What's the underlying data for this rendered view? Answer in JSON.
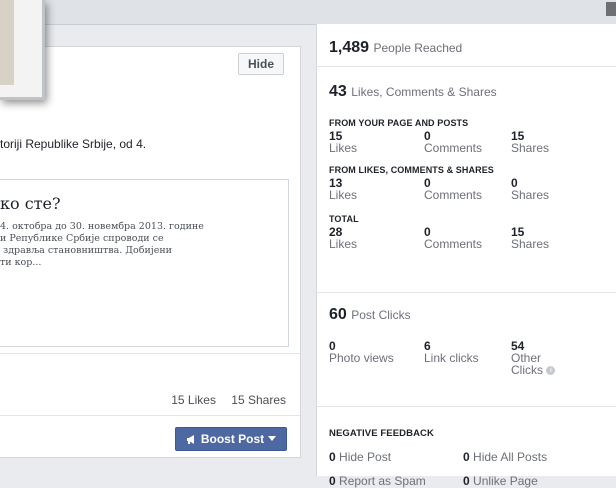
{
  "post": {
    "hide_label": "Hide",
    "text": "toriji Republike Srbije, od 4.",
    "link_title": "ко сте?",
    "link_desc": "4. октобра до 30. новембра 2013. године\nи Републике Србије спроводи се\n здравља становништва. Добијени\nти кор...",
    "likes_count": "15 Likes",
    "shares_count": "15 Shares",
    "boost_label": "Boost Post"
  },
  "insights": {
    "reach_value": "1,489",
    "reach_label": "People Reached",
    "engagement_value": "43",
    "engagement_label": "Likes, Comments & Shares",
    "groups": [
      {
        "header": "FROM YOUR PAGE AND POSTS",
        "likes": "15",
        "likes_label": "Likes",
        "comments": "0",
        "comments_label": "Comments",
        "shares": "15",
        "shares_label": "Shares"
      },
      {
        "header": "FROM LIKES, COMMENTS & SHARES",
        "likes": "13",
        "likes_label": "Likes",
        "comments": "0",
        "comments_label": "Comments",
        "shares": "0",
        "shares_label": "Shares"
      },
      {
        "header": "TOTAL",
        "likes": "28",
        "likes_label": "Likes",
        "comments": "0",
        "comments_label": "Comments",
        "shares": "15",
        "shares_label": "Shares"
      }
    ],
    "clicks_value": "60",
    "clicks_label": "Post Clicks",
    "photo_views": "0",
    "photo_views_label": "Photo views",
    "link_clicks": "6",
    "link_clicks_label": "Link clicks",
    "other_clicks": "54",
    "other_clicks_label_1": "Other",
    "other_clicks_label_2": "Clicks",
    "negative_header": "NEGATIVE FEEDBACK",
    "hide_post_value": "0",
    "hide_post_label": "Hide Post",
    "hide_all_value": "0",
    "hide_all_label": "Hide All Posts",
    "spam_value": "0",
    "spam_label": "Report as Spam",
    "unlike_value": "0",
    "unlike_label": "Unlike Page"
  },
  "colors": {
    "boost_bg": "#4e69a2",
    "page_bg": "#e9ebee"
  },
  "icons": {
    "boost": "megaphone-icon",
    "dropdown": "caret-down-icon",
    "info": "info-icon"
  }
}
